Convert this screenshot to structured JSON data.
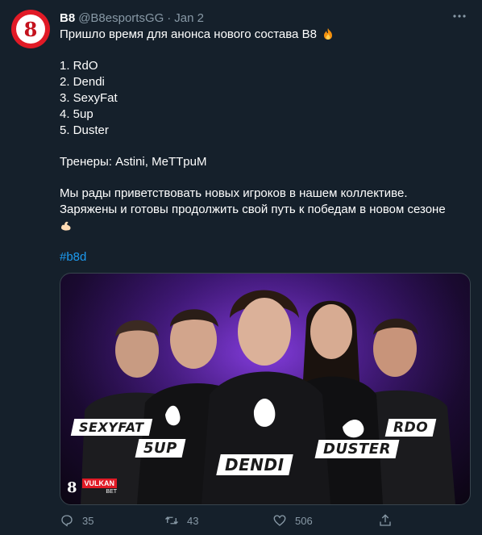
{
  "tweet": {
    "author_name": "B8",
    "handle": "@B8esportsGG",
    "separator": "·",
    "date": "Jan 2",
    "avatar_text": "8",
    "more_icon": "more-icon",
    "lines": [
      "Пришло время для анонса нового состава B8",
      "1. RdO",
      "2. Dendi",
      "3. SexyFat",
      "4. 5up",
      "5. Duster",
      "Тренеры: Astini, MeTTpuM",
      "Мы рады приветствовать новых игроков в нашем коллективе.",
      "Заряжены и готовы продолжить свой путь к победам в новом сезоне"
    ],
    "hashtag": "#b8d"
  },
  "media": {
    "player_tags": [
      "SEXYFAT",
      "5UP",
      "DENDI",
      "DUSTER",
      "RDO"
    ],
    "sponsor_logo_text": "8",
    "sponsor_name": "VULKAN",
    "sponsor_sub": "BET",
    "accent": "#7b2fd0"
  },
  "actions": {
    "replies": "35",
    "retweets": "43",
    "likes": "506"
  },
  "colors": {
    "background": "#15202b",
    "secondary_text": "#8899a6",
    "link": "#1d9bf0"
  }
}
